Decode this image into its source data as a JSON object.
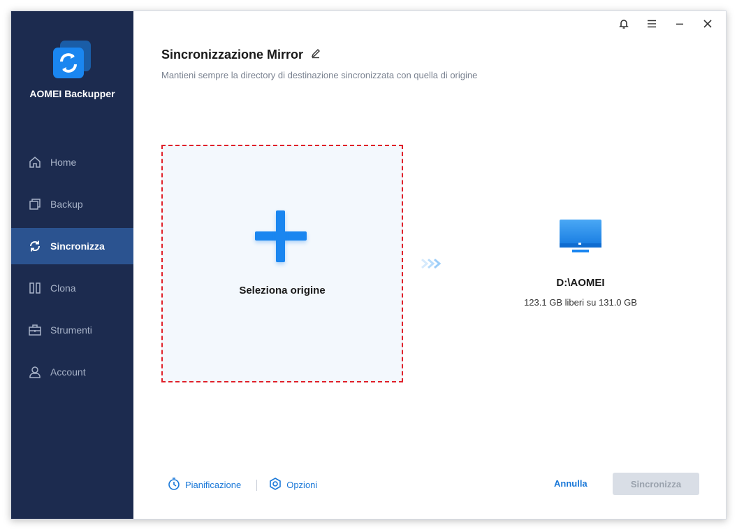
{
  "app": {
    "brand": "AOMEI Backupper"
  },
  "sidebar": {
    "items": [
      {
        "label": "Home",
        "icon": "home-icon",
        "active": false
      },
      {
        "label": "Backup",
        "icon": "backup-icon",
        "active": false
      },
      {
        "label": "Sincronizza",
        "icon": "sync-icon",
        "active": true
      },
      {
        "label": "Clona",
        "icon": "clone-icon",
        "active": false
      },
      {
        "label": "Strumenti",
        "icon": "toolbox-icon",
        "active": false
      },
      {
        "label": "Account",
        "icon": "user-icon",
        "active": false
      }
    ]
  },
  "header": {
    "title": "Sincronizzazione Mirror",
    "subtitle": "Mantieni sempre la directory di destinazione sincronizzata con quella di origine"
  },
  "source": {
    "label": "Seleziona origine"
  },
  "destination": {
    "name": "D:\\AOMEI",
    "free": "123.1 GB liberi su 131.0 GB"
  },
  "footer": {
    "schedule_label": "Pianificazione",
    "options_label": "Opzioni",
    "cancel_label": "Annulla",
    "sync_label": "Sincronizza"
  },
  "colors": {
    "sidebar_bg": "#1c2b4f",
    "sidebar_active": "#2b5390",
    "accent": "#1a78d8",
    "highlight_border": "#e0202a"
  }
}
